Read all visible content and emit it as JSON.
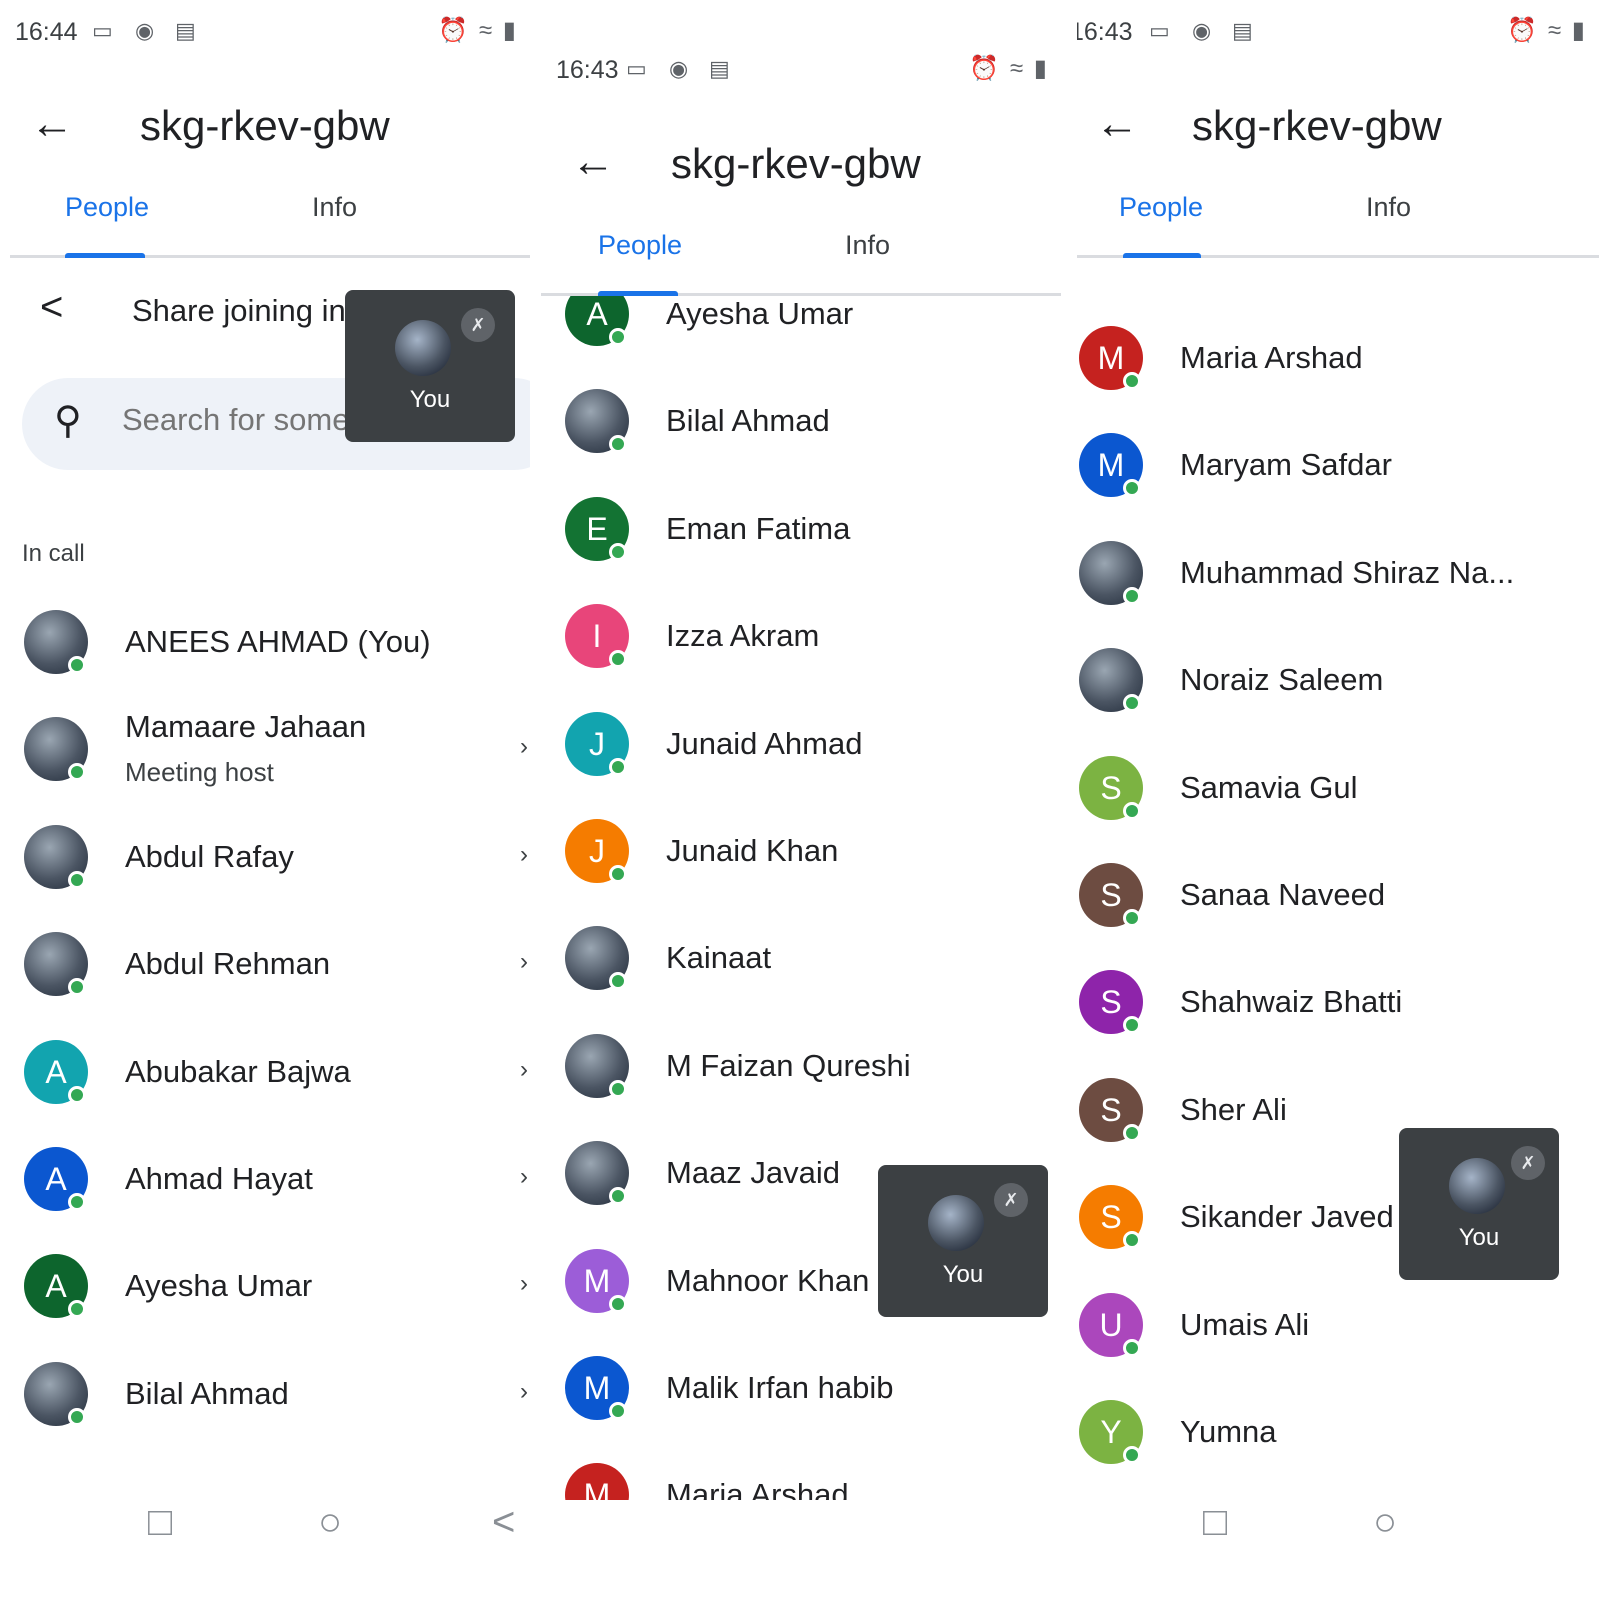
{
  "status_bar": {
    "panel1_time": "16:44",
    "panel2_time": "16:43",
    "panel3_time": "16:43",
    "icons": [
      "video-icon",
      "record-icon",
      "gamepad-icon",
      "alarm-icon",
      "wifi-icon",
      "signal-icon"
    ]
  },
  "meeting_code": "skg-rkev-gbw",
  "tabs": {
    "people": "People",
    "info": "Info"
  },
  "share_label": "Share joining inf",
  "search_placeholder": "Search for some",
  "section_in_call": "In call",
  "self_tile_label": "You",
  "host_subtitle": "Meeting host",
  "colors": {
    "accent": "#1a73e8",
    "online": "#34a853",
    "tile_bg": "#3c4043",
    "search_bg": "#eef2f8"
  },
  "panel1_people": [
    {
      "name": "ANEES AHMAD (You)",
      "initial": "",
      "photo": true
    },
    {
      "name": "Mamaare Jahaan",
      "initial": "",
      "photo": true,
      "subtitle": "Meeting host"
    },
    {
      "name": "Abdul Rafay",
      "initial": "",
      "photo": true
    },
    {
      "name": "Abdul Rehman",
      "initial": "",
      "photo": true
    },
    {
      "name": "Abubakar Bajwa",
      "initial": "A",
      "color": "#12a4af"
    },
    {
      "name": "Ahmad Hayat",
      "initial": "A",
      "color": "#0b57d0"
    },
    {
      "name": "Ayesha Umar",
      "initial": "A",
      "color": "#0d652d"
    },
    {
      "name": "Bilal Ahmad",
      "initial": "",
      "photo": true
    }
  ],
  "panel2_people": [
    {
      "name": "Ayesha Umar",
      "initial": "A",
      "color": "#0d652d"
    },
    {
      "name": "Bilal Ahmad",
      "initial": "",
      "photo": true
    },
    {
      "name": "Eman Fatima",
      "initial": "E",
      "color": "#137333"
    },
    {
      "name": "Izza Akram",
      "initial": "I",
      "color": "#e8457a"
    },
    {
      "name": "Junaid Ahmad",
      "initial": "J",
      "color": "#12a4af"
    },
    {
      "name": "Junaid Khan",
      "initial": "J",
      "color": "#f57c00"
    },
    {
      "name": "Kainaat",
      "initial": "",
      "photo": true
    },
    {
      "name": "M Faizan Qureshi",
      "initial": "",
      "photo": true
    },
    {
      "name": "Maaz Javaid",
      "initial": "",
      "photo": true
    },
    {
      "name": "Mahnoor Khan",
      "initial": "M",
      "color": "#9c5dd8"
    },
    {
      "name": "Malik Irfan habib",
      "initial": "M",
      "color": "#0b57d0"
    },
    {
      "name": "Maria Arshad",
      "initial": "M",
      "color": "#c5221f"
    }
  ],
  "panel3_people": [
    {
      "name": "Maria Arshad",
      "initial": "M",
      "color": "#c5221f"
    },
    {
      "name": "Maryam Safdar",
      "initial": "M",
      "color": "#0b57d0"
    },
    {
      "name": "Muhammad Shiraz Na...",
      "initial": "",
      "photo": true
    },
    {
      "name": "Noraiz Saleem",
      "initial": "",
      "photo": true
    },
    {
      "name": "Samavia Gul",
      "initial": "S",
      "color": "#7cb342"
    },
    {
      "name": "Sanaa Naveed",
      "initial": "S",
      "color": "#6d4c41"
    },
    {
      "name": "Shahwaiz Bhatti",
      "initial": "S",
      "color": "#8e24aa"
    },
    {
      "name": "Sher Ali",
      "initial": "S",
      "color": "#6d4c41"
    },
    {
      "name": "Sikander Javed",
      "initial": "S",
      "color": "#f57c00"
    },
    {
      "name": "Umais Ali",
      "initial": "U",
      "color": "#ab47bc"
    },
    {
      "name": "Yumna",
      "initial": "Y",
      "color": "#7cb342"
    }
  ]
}
